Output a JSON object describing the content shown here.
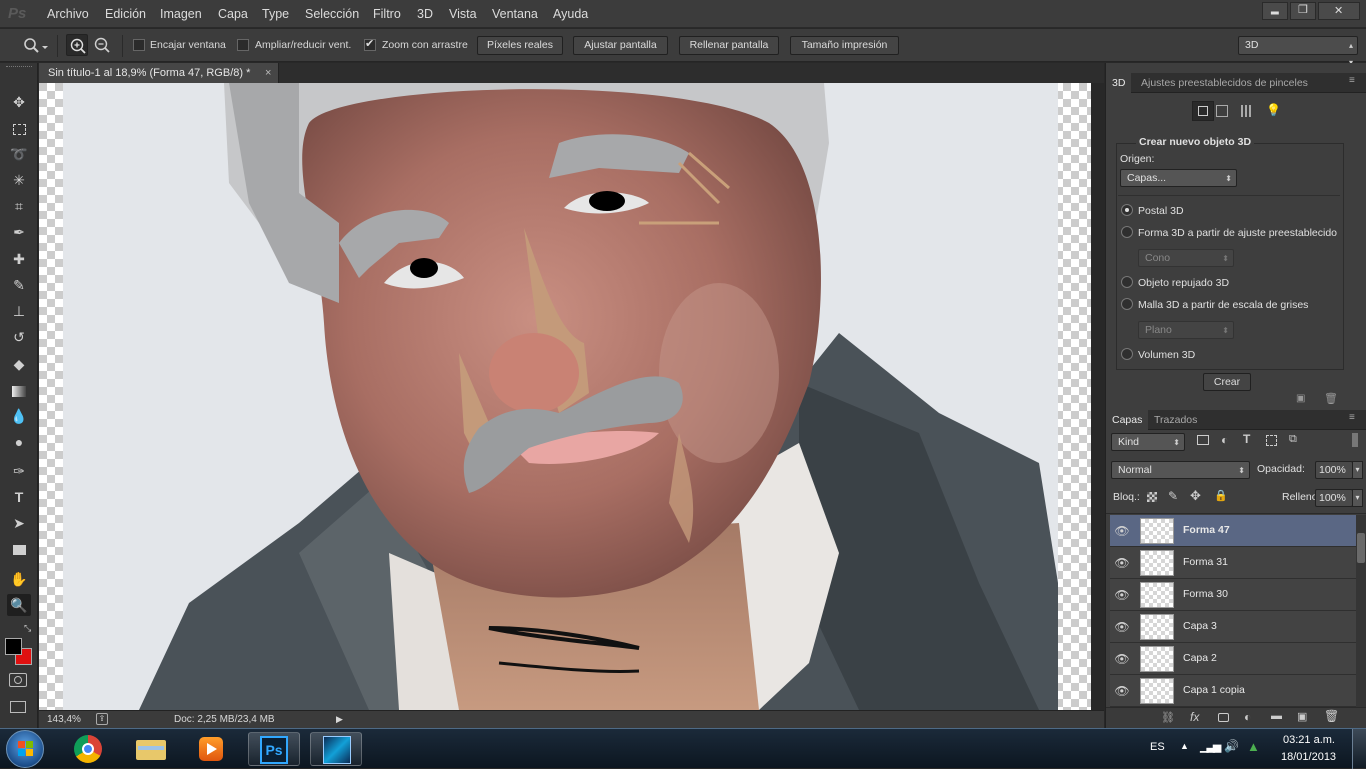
{
  "app": {
    "logo": "Ps"
  },
  "menu": [
    "Archivo",
    "Edición",
    "Imagen",
    "Capa",
    "Type",
    "Selección",
    "Filtro",
    "3D",
    "Vista",
    "Ventana",
    "Ayuda"
  ],
  "window_controls": {
    "minimize": "▂",
    "restore": "❐",
    "close": "✕"
  },
  "options": {
    "encajar_ventana": {
      "label": "Encajar ventana",
      "checked": false
    },
    "ampliar": {
      "label": "Ampliar/reducir vent.",
      "checked": false
    },
    "zoom_arrastre": {
      "label": "Zoom con arrastre",
      "checked": true
    },
    "buttons": [
      "Píxeles reales",
      "Ajustar pantalla",
      "Rellenar pantalla",
      "Tamaño impresión"
    ],
    "workspace": "3D"
  },
  "tools": [
    "move-icon",
    "marquee-icon",
    "lasso-icon",
    "magic-wand-icon",
    "crop-icon",
    "eyedropper-icon",
    "healing-icon",
    "brush-icon",
    "stamp-icon",
    "history-brush-icon",
    "eraser-icon",
    "gradient-icon",
    "blur-icon",
    "dodge-icon",
    "pen-icon",
    "type-icon",
    "path-select-icon",
    "rectangle-icon",
    "hand-icon",
    "zoom-icon"
  ],
  "colors": {
    "foreground": "#000000",
    "background": "#e01010",
    "selected_layer": "#5a6784",
    "accent": "#31a8ff"
  },
  "document": {
    "tab_title": "Sin título-1 al 18,9% (Forma 47, RGB/8) *",
    "tab_close": "×"
  },
  "status": {
    "zoom": "143,4%",
    "doc_info": "Doc: 2,25 MB/23,4 MB"
  },
  "panel3d": {
    "tabs": [
      "3D",
      "Ajustes preestablecidos de pinceles"
    ],
    "section_title": "Crear nuevo objeto 3D",
    "origen_label": "Origen:",
    "origen_value": "Capas...",
    "options": [
      {
        "label": "Postal 3D",
        "selected": true
      },
      {
        "label": "Forma 3D a partir de ajuste preestablecido",
        "selected": false
      },
      {
        "label": "Objeto repujado 3D",
        "selected": false
      },
      {
        "label": "Malla 3D a partir de escala de grises",
        "selected": false
      },
      {
        "label": "Volumen 3D",
        "selected": false
      }
    ],
    "preset_shape": "Cono",
    "grayscale_mesh": "Plano",
    "create_button": "Crear"
  },
  "layers_panel": {
    "tabs": [
      "Capas",
      "Trazados"
    ],
    "filter_kind": "Kind",
    "blend_mode": "Normal",
    "opacity_label": "Opacidad:",
    "opacity_value": "100%",
    "lock_label": "Bloq.:",
    "fill_label": "Relleno:",
    "fill_value": "100%",
    "layers": [
      {
        "name": "Forma 47",
        "selected": true
      },
      {
        "name": "Forma 31",
        "selected": false
      },
      {
        "name": "Forma 30",
        "selected": false
      },
      {
        "name": "Capa 3",
        "selected": false
      },
      {
        "name": "Capa 2",
        "selected": false
      },
      {
        "name": "Capa 1 copia",
        "selected": false
      }
    ],
    "footer_fx": "fx"
  },
  "taskbar": {
    "apps": [
      "windows-start-icon",
      "chrome-icon",
      "explorer-icon",
      "media-player-icon",
      "photoshop-icon",
      "game-icon"
    ],
    "ps_label": "Ps",
    "language": "ES",
    "time": "03:21 a.m.",
    "date": "18/01/2013"
  }
}
